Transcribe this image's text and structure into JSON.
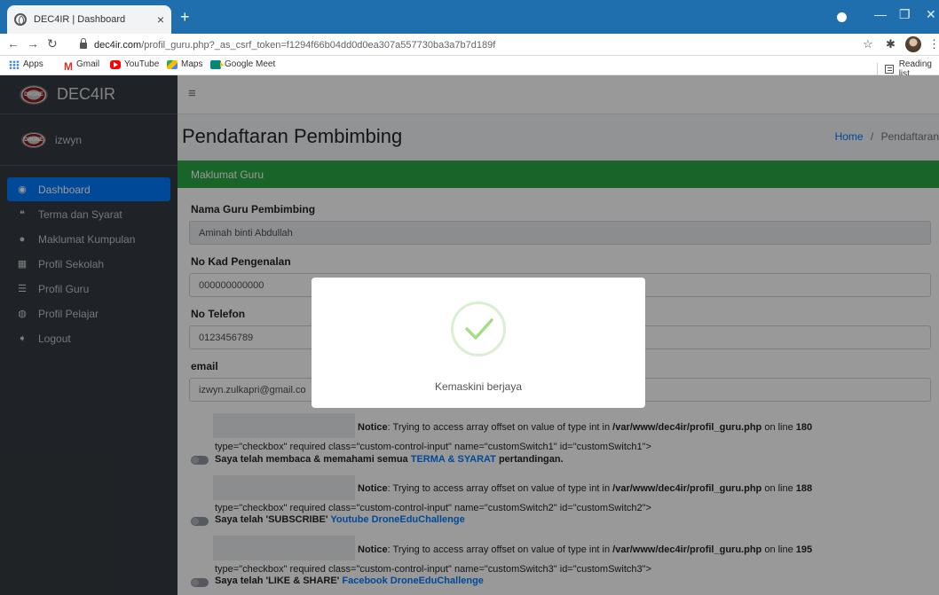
{
  "browser": {
    "tab_title": "DEC4IR | Dashboard",
    "tab_close": "×",
    "new_tab": "+",
    "url_host": "dec4ir.com",
    "url_path": "/profil_guru.php?_as_csrf_token=f1294f66b04dd0d0ea307a557730ba3a7b7d189f",
    "bookmarks": [
      "Apps",
      "Gmail",
      "YouTube",
      "Maps",
      "Google Meet"
    ],
    "reading_list": "Reading list"
  },
  "sidebar": {
    "brand": "DEC4IR",
    "logo_text": "DRONE",
    "user": "izwyn",
    "items": [
      {
        "label": "Dashboard",
        "icon": "tachometer-icon",
        "glyph": "◉",
        "active": true
      },
      {
        "label": "Terma dan Syarat",
        "icon": "quote-icon",
        "glyph": "❝",
        "active": false
      },
      {
        "label": "Maklumat Kumpulan",
        "icon": "drop-icon",
        "glyph": "●",
        "active": false
      },
      {
        "label": "Profil Sekolah",
        "icon": "building-icon",
        "glyph": "▦",
        "active": false
      },
      {
        "label": "Profil Guru",
        "icon": "list-icon",
        "glyph": "☰",
        "active": false
      },
      {
        "label": "Profil Pelajar",
        "icon": "user-circle-icon",
        "glyph": "◍",
        "active": false
      },
      {
        "label": "Logout",
        "icon": "logout-icon",
        "glyph": "➧",
        "active": false
      }
    ]
  },
  "header": {
    "menu_glyph": "≡",
    "page_title": "Pendaftaran Pembimbing",
    "breadcrumb_home": "Home",
    "breadcrumb_sep": "/",
    "breadcrumb_current": "Pendaftaran"
  },
  "card": {
    "title": "Maklumat Guru",
    "fields": [
      {
        "label": "Nama Guru Pembimbing",
        "value": "Aminah binti Abdullah",
        "readonly": true
      },
      {
        "label": "No Kad Pengenalan",
        "value": "000000000000",
        "readonly": false
      },
      {
        "label": "No Telefon",
        "value": "0123456789",
        "readonly": false
      },
      {
        "label": "email",
        "value": "izwyn.zulkapri@gmail.co",
        "readonly": false
      }
    ],
    "notices": [
      {
        "notice_word": "Notice",
        "notice_text": ": Trying to access array offset on value of type int in ",
        "path": "/var/www/dec4ir/profil_guru.php",
        "line_text": " on line ",
        "line": "180",
        "raw": "type=\"checkbox\" required class=\"custom-control-input\" name=\"customSwitch1\" id=\"customSwitch1\">",
        "label": "Saya telah membaca & memahami semua ",
        "link": "TERMA & SYARAT",
        "label_after": " pertandingan."
      },
      {
        "notice_word": "Notice",
        "notice_text": ": Trying to access array offset on value of type int in ",
        "path": "/var/www/dec4ir/profil_guru.php",
        "line_text": " on line ",
        "line": "188",
        "raw": "type=\"checkbox\" required class=\"custom-control-input\" name=\"customSwitch2\" id=\"customSwitch2\">",
        "label": "Saya telah 'SUBSCRIBE' ",
        "link": "Youtube DroneEduChallenge",
        "label_after": ""
      },
      {
        "notice_word": "Notice",
        "notice_text": ": Trying to access array offset on value of type int in ",
        "path": "/var/www/dec4ir/profil_guru.php",
        "line_text": " on line ",
        "line": "195",
        "raw": "type=\"checkbox\" required class=\"custom-control-input\" name=\"customSwitch3\" id=\"customSwitch3\">",
        "label": "Saya telah 'LIKE & SHARE' ",
        "link": "Facebook DroneEduChallenge",
        "label_after": ""
      }
    ]
  },
  "modal": {
    "message": "Kemaskini berjaya",
    "icon": "success-check-icon"
  },
  "colors": {
    "sidebar_bg": "#343a40",
    "active_item": "#007bff",
    "card_header": "#28a745",
    "link": "#007bff",
    "check": "#a5dc86"
  }
}
